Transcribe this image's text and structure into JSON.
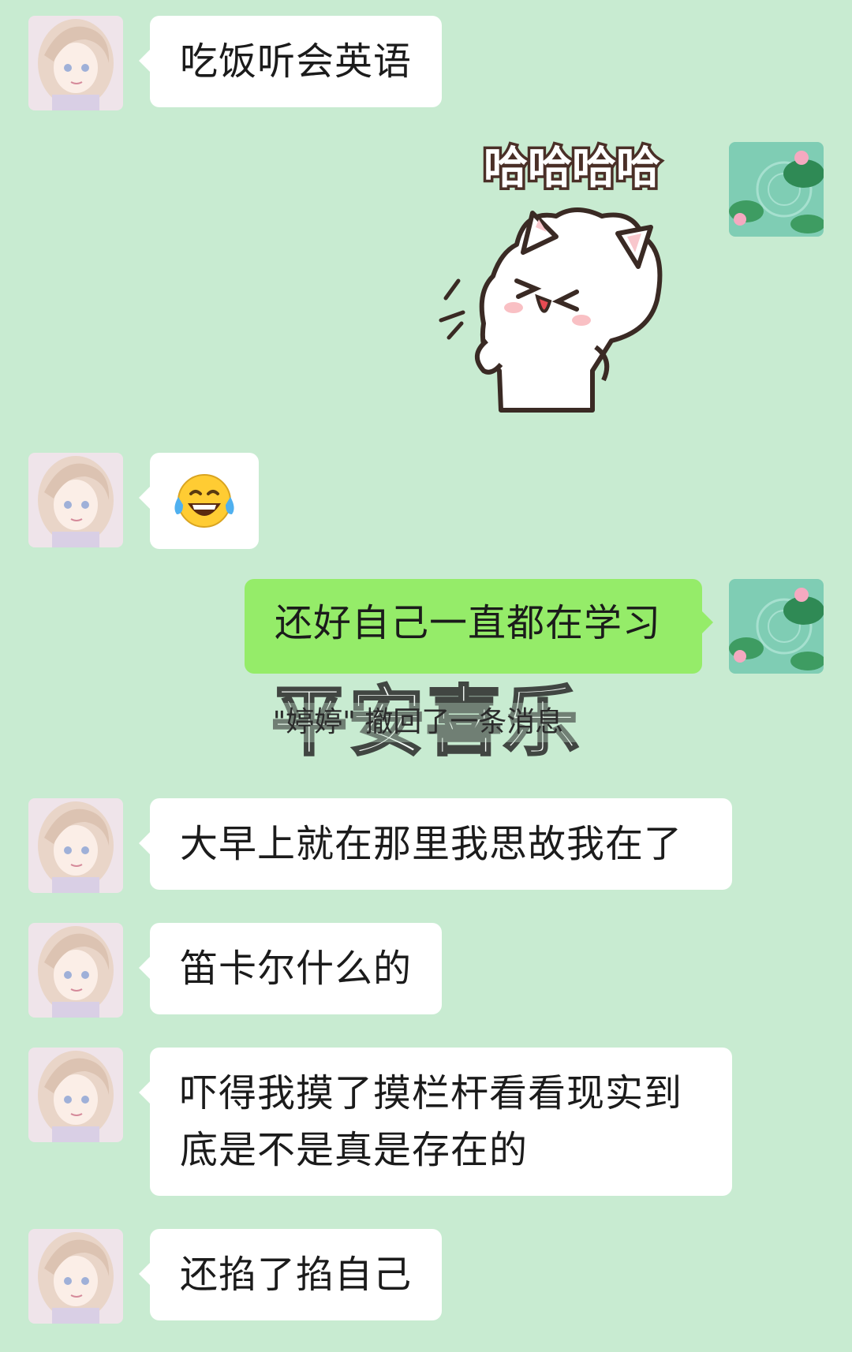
{
  "chat": {
    "messages": [
      {
        "sender": "other",
        "text": "吃饭听会英语"
      },
      {
        "sender": "me",
        "sticker": "laughing-white-cat-sticker",
        "sticker_text": "哈哈哈哈"
      },
      {
        "sender": "other",
        "emoji": "😂"
      },
      {
        "sender": "me",
        "text": "还好自己一直都在学习"
      },
      {
        "sender": "other",
        "text": "大早上就在那里我思故我在了"
      },
      {
        "sender": "other",
        "text": "笛卡尔什么的"
      },
      {
        "sender": "other",
        "text": "吓得我摸了摸栏杆看看现实到底是不是真是存在的"
      },
      {
        "sender": "other",
        "text": "还掐了掐自己"
      }
    ],
    "recall_notice": "\"婷婷\" 撤回了一条消息",
    "watermark": "平安喜乐"
  },
  "icons": {
    "other_avatar": "anime-girl-avatar",
    "my_avatar": "lotus-pond-avatar"
  },
  "colors": {
    "background": "#c8ebd1",
    "bubble_other": "#ffffff",
    "bubble_me": "#95ec69"
  }
}
